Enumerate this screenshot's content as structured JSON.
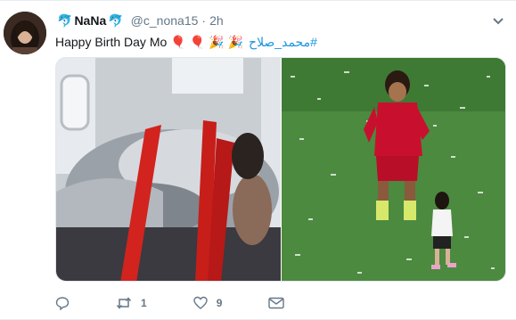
{
  "tweet": {
    "display_name": "NaNa",
    "handle": "@c_nona15",
    "separator": "·",
    "time": "2h",
    "text": "Happy Birth Day Mo",
    "hashtag": "#محمد_صلاح",
    "retweet_count": "1",
    "like_count": "9"
  },
  "icons": {
    "name_decoration": "dolphin-icon",
    "reply": "reply-icon",
    "retweet": "retweet-icon",
    "like": "heart-icon",
    "dm": "envelope-icon",
    "caret": "chevron-down-icon"
  },
  "colors": {
    "link": "#1b95e0",
    "muted": "#657786",
    "name": "#14171a"
  }
}
